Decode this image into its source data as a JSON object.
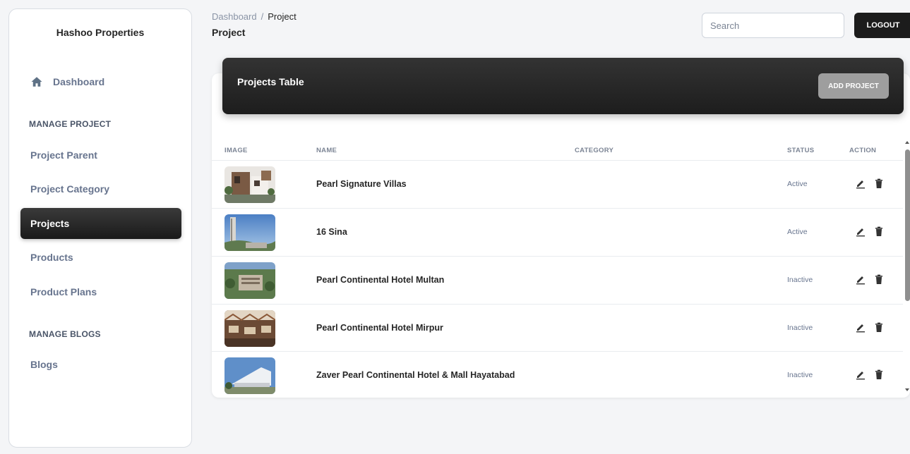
{
  "sidebar": {
    "brand": "Hashoo Properties",
    "dashboard_label": "Dashboard",
    "manage_project_title": "MANAGE PROJECT",
    "items": [
      {
        "label": "Project Parent"
      },
      {
        "label": "Project Category"
      },
      {
        "label": "Projects",
        "active": true
      },
      {
        "label": "Products"
      },
      {
        "label": "Product Plans"
      }
    ],
    "manage_blogs_title": "MANAGE BLOGS",
    "blogs_label": "Blogs"
  },
  "header": {
    "breadcrumb_root": "Dashboard",
    "breadcrumb_sep": "/",
    "breadcrumb_current": "Project",
    "page_title": "Project",
    "search_placeholder": "Search",
    "logout_label": "LOGOUT"
  },
  "card": {
    "title": "Projects Table",
    "add_label": "ADD PROJECT"
  },
  "table": {
    "columns": [
      "IMAGE",
      "NAME",
      "CATEGORY",
      "STATUS",
      "ACTION"
    ],
    "rows": [
      {
        "name": "Pearl Signature Villas",
        "category": "",
        "status": "Active"
      },
      {
        "name": "16 Sina",
        "category": "",
        "status": "Active"
      },
      {
        "name": "Pearl Continental Hotel Multan",
        "category": "",
        "status": "Inactive"
      },
      {
        "name": "Pearl Continental Hotel Mirpur",
        "category": "",
        "status": "Inactive"
      },
      {
        "name": "Zaver Pearl Continental Hotel & Mall Hayatabad",
        "category": "",
        "status": "Inactive"
      }
    ]
  },
  "icons": {
    "dashboard": "home-icon",
    "edit": "pencil-icon",
    "delete": "trash-icon"
  },
  "colors": {
    "accent_dark": "#1c1c1c",
    "add_button": "#9e9e9e",
    "page_bg": "#f4f5f7"
  }
}
